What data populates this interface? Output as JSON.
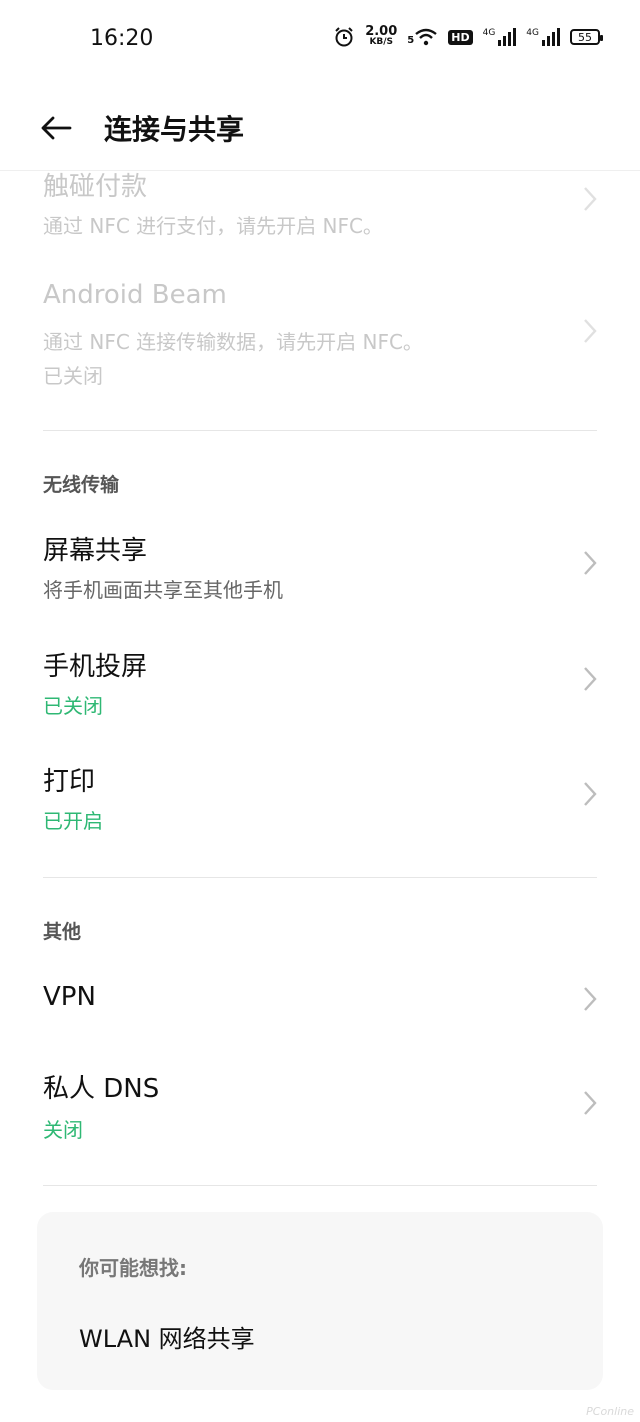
{
  "status": {
    "time": "16:20",
    "speed_value": "2.00",
    "speed_unit": "KB/S",
    "wifi_badge": "5",
    "hd_badge": "HD",
    "net1": "4G",
    "net2": "4G",
    "battery": "55"
  },
  "header": {
    "title": "连接与共享"
  },
  "nfc_items": [
    {
      "title": "触碰付款",
      "subtitle": "通过 NFC 进行支付，请先开启 NFC。"
    },
    {
      "title": "Android Beam",
      "subtitle": "通过 NFC 连接传输数据，请先开启 NFC。",
      "status": "已关闭"
    }
  ],
  "wireless": {
    "header": "无线传输",
    "items": [
      {
        "title": "屏幕共享",
        "subtitle": "将手机画面共享至其他手机"
      },
      {
        "title": "手机投屏",
        "subtitle": "已关闭"
      },
      {
        "title": "打印",
        "subtitle": "已开启"
      }
    ]
  },
  "other": {
    "header": "其他",
    "items": [
      {
        "title": "VPN"
      },
      {
        "title": "私人 DNS",
        "subtitle": "关闭"
      }
    ]
  },
  "suggest": {
    "title": "你可能想找:",
    "link": "WLAN 网络共享"
  },
  "watermark": "PConline",
  "colors": {
    "accent_green": "#2fb874",
    "faded_text": "#c8c8c8"
  }
}
